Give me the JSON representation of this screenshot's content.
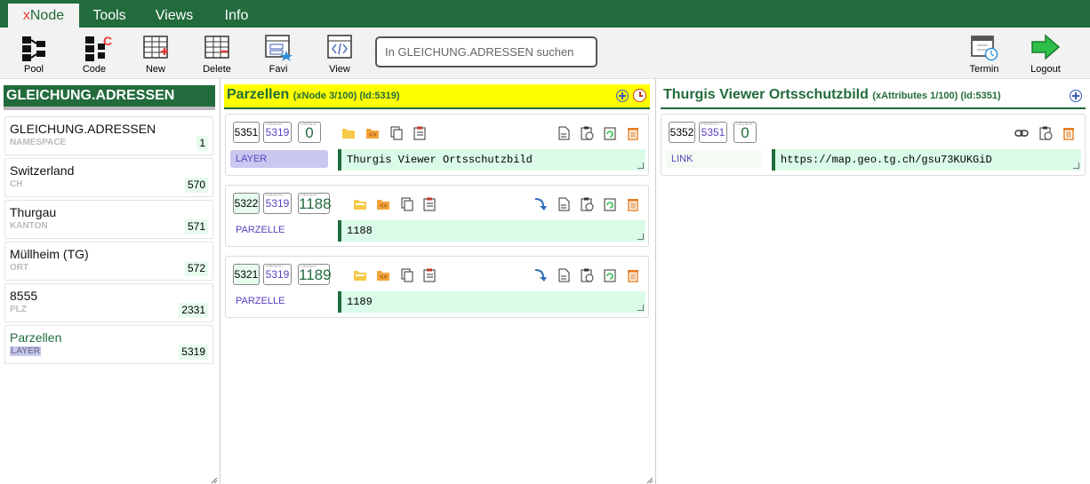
{
  "menu": {
    "tabs": [
      {
        "label_prefix": "x",
        "label_rest": "Node",
        "active": true
      },
      {
        "label": "Tools"
      },
      {
        "label": "Views"
      },
      {
        "label": "Info"
      }
    ]
  },
  "toolbar": {
    "pool": "Pool",
    "code": "Code",
    "new": "New",
    "delete": "Delete",
    "favi": "Favi",
    "view": "View",
    "search_placeholder": "In GLEICHUNG.ADRESSEN suchen",
    "termin": "Termin",
    "logout": "Logout"
  },
  "left": {
    "title": "GLEICHUNG.ADRESSEN",
    "items": [
      {
        "name": "GLEICHUNG.ADRESSEN",
        "type": "NAMESPACE",
        "num": "1"
      },
      {
        "name": "Switzerland",
        "type": "CH",
        "num": "570"
      },
      {
        "name": "Thurgau",
        "type": "KANTON",
        "num": "571"
      },
      {
        "name": "Müllheim (TG)",
        "type": "ORT",
        "num": "572"
      },
      {
        "name": "8555",
        "type": "PLZ",
        "num": "2331"
      },
      {
        "name": "Parzellen",
        "type": "LAYER",
        "num": "5319"
      }
    ]
  },
  "middle": {
    "title": "Parzellen",
    "meta_kind": "(xNode",
    "meta_count": "3/100)",
    "meta_id": "(Id:5319)",
    "nodes": [
      {
        "id": "5351",
        "parent": "5319",
        "order": "0",
        "type": "LAYER",
        "value": "Thurgis Viewer Ortsschutzbild"
      },
      {
        "id": "5322",
        "parent": "5319",
        "order": "1188",
        "type": "PARZELLE",
        "value": "1188"
      },
      {
        "id": "5321",
        "parent": "5319",
        "order": "1189",
        "type": "PARZELLE",
        "value": "1189"
      }
    ]
  },
  "right": {
    "title": "Thurgis Viewer Ortsschutzbild",
    "meta_kind": "(xAttributes",
    "meta_count": "1/100)",
    "meta_id": "(Id:5351)",
    "nodes": [
      {
        "id": "5352",
        "parent": "5351",
        "order": "0",
        "type": "LINK",
        "value": "https://map.geo.tg.ch/gsu73KUKGiD"
      }
    ]
  },
  "colors": {
    "brand_green": "#226b3c",
    "header_yellow": "#ffff00",
    "value_bg": "#d9fbe8",
    "type_purple": "#5b3fbf"
  }
}
